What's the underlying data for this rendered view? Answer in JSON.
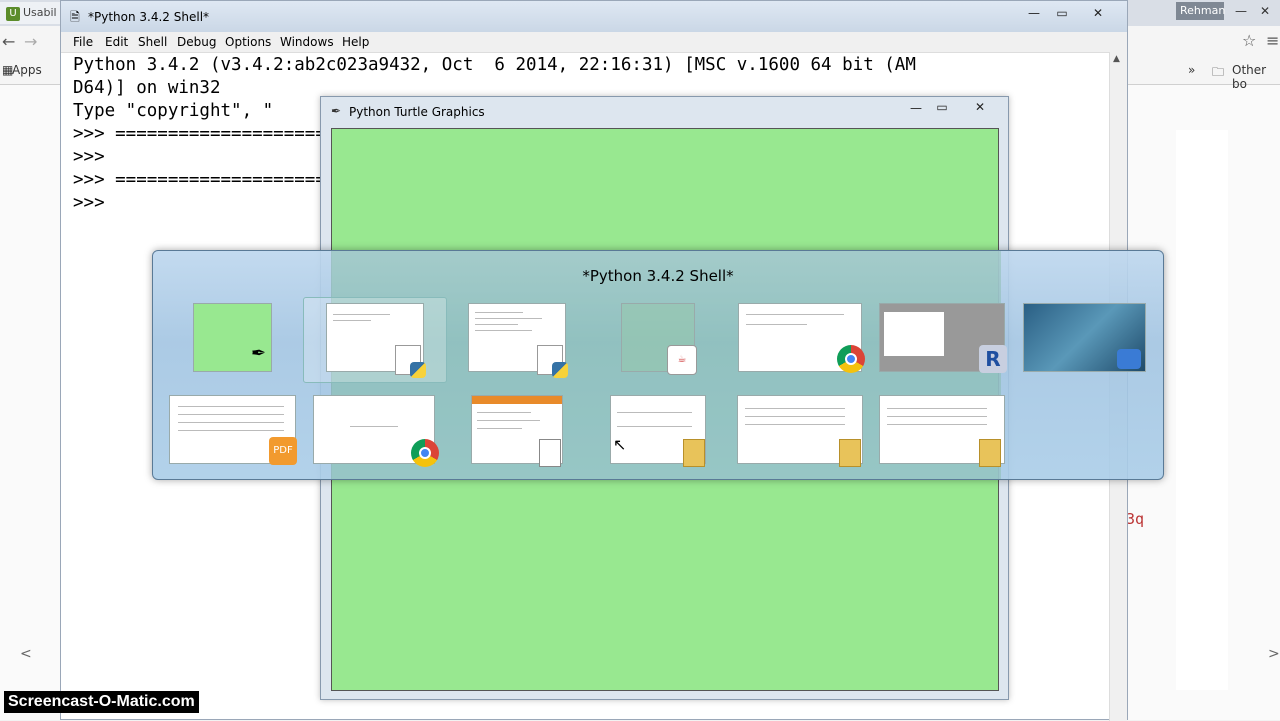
{
  "chrome": {
    "tab_label": "Usabil",
    "tab_icon_letter": "U",
    "user_name": "Rehman",
    "bookmarks": {
      "apps_label": "Apps",
      "other_label": "Other bo"
    },
    "minimize": "—",
    "restore": "❐",
    "close": "✕",
    "red_text": "3q"
  },
  "shell": {
    "title": "*Python 3.4.2 Shell*",
    "minimize": "—",
    "restore": "▭",
    "close": "✕",
    "menu": [
      "File",
      "Edit",
      "Shell",
      "Debug",
      "Options",
      "Windows",
      "Help"
    ],
    "lines": [
      "Python 3.4.2 (v3.4.2:ab2c023a9432, Oct  6 2014, 22:16:31) [MSC v.1600 64 bit (AM",
      "D64)] on win32",
      "Type \"copyright\", \"",
      ">>> ========================================================================",
      ">>> ",
      ">>> ========================================================================",
      ">>> "
    ]
  },
  "turtle": {
    "title": "Python Turtle Graphics",
    "minimize": "—",
    "restore": "▭",
    "close": "✕",
    "canvas_color": "#98e890"
  },
  "switcher": {
    "title": "*Python 3.4.2 Shell*",
    "thumbnails_row1": [
      "turtle-graphics",
      "python-shell",
      "python-editor",
      "java-app",
      "chrome-window",
      "r-console",
      "desktop"
    ],
    "thumbnails_row2": [
      "pdf-document",
      "chrome-google",
      "text-document",
      "explorer-folder",
      "explorer-folder",
      "explorer-folder"
    ],
    "badge_pdf": "PDF",
    "badge_r": "R"
  },
  "watermark": "Screencast-O-Matic.com"
}
